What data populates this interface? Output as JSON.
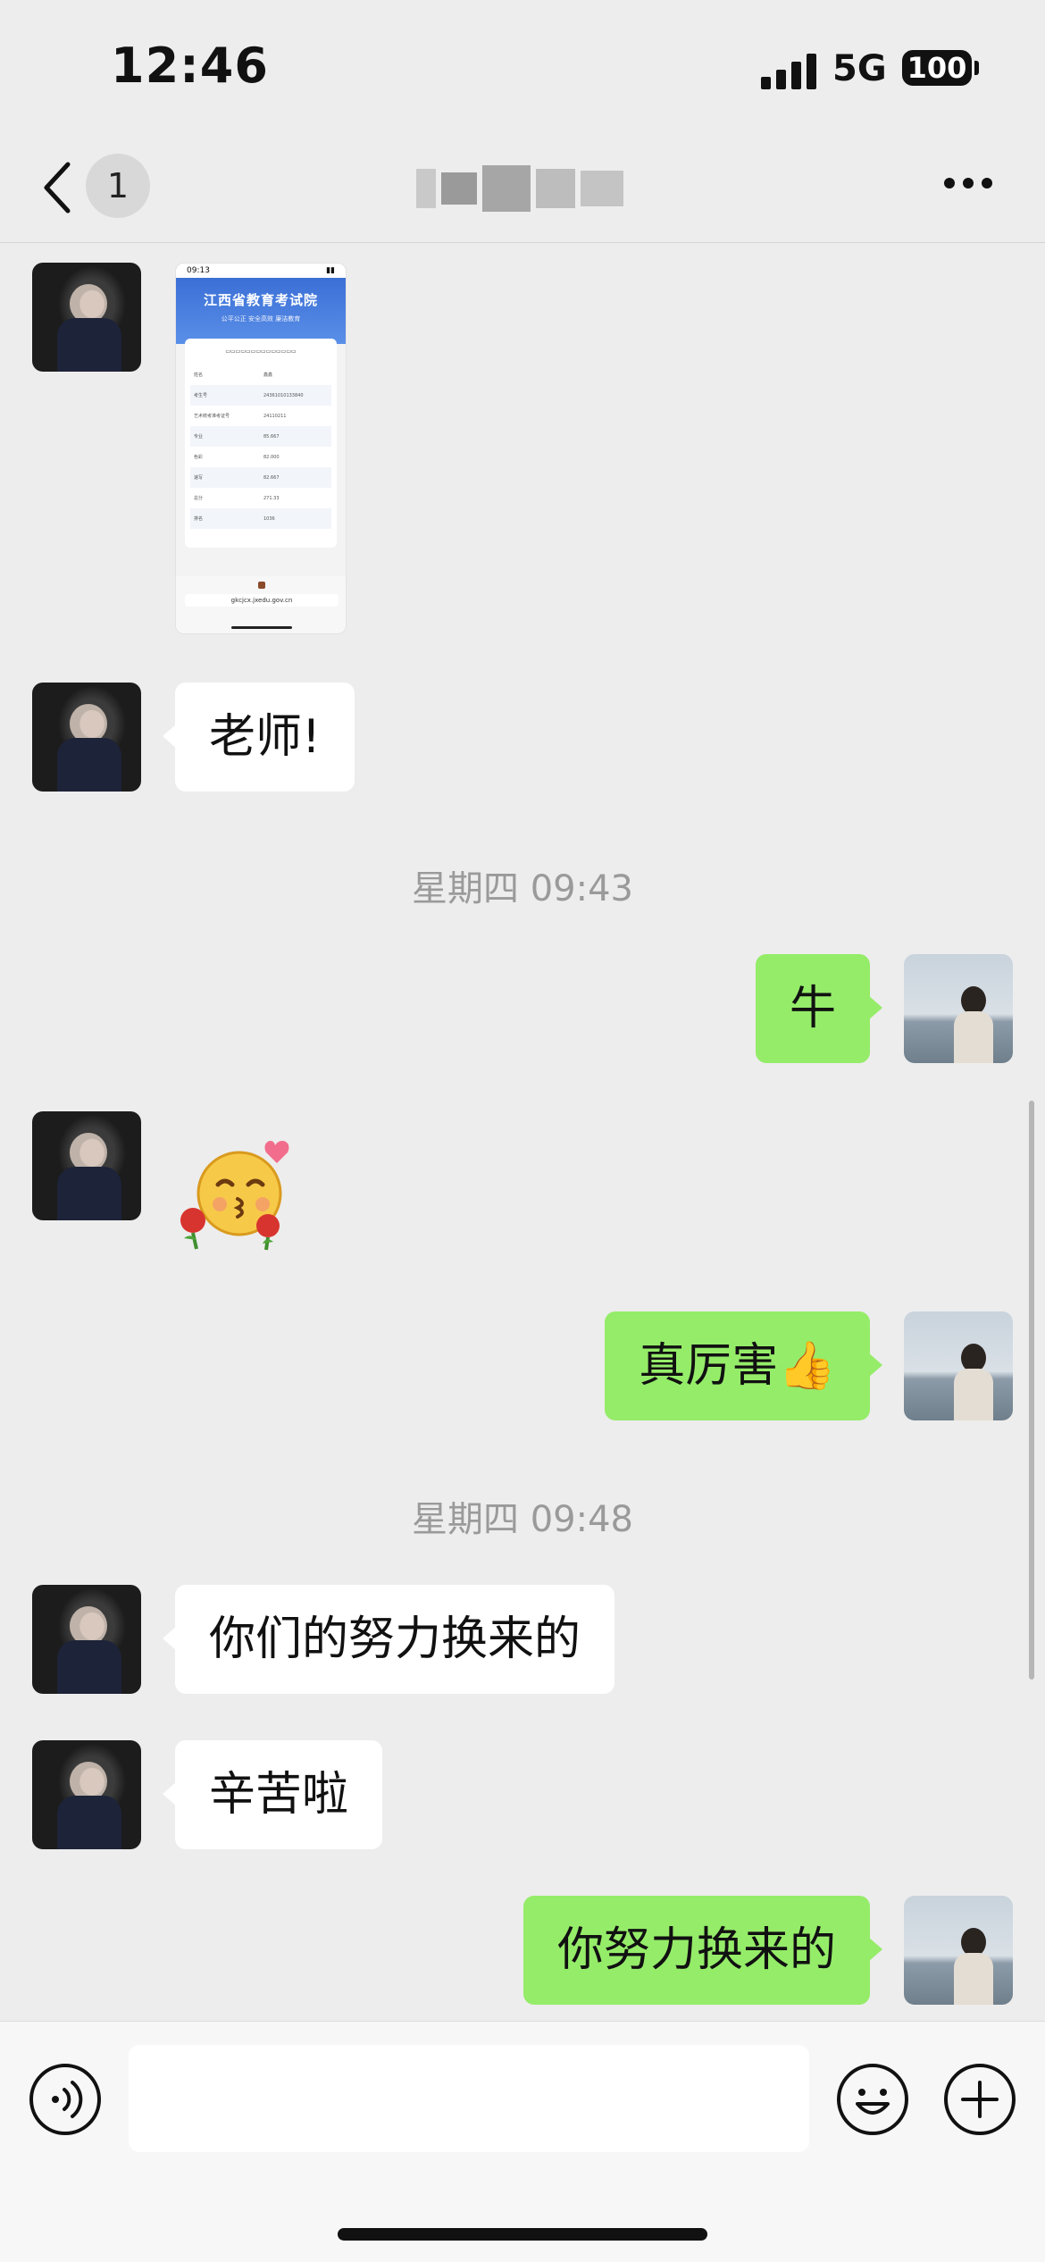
{
  "status_bar": {
    "time": "12:46",
    "network": "5G",
    "battery": "100"
  },
  "nav": {
    "unread_count": "1",
    "title": ""
  },
  "thumbnail": {
    "time": "09:13",
    "header_title": "江西省教育考试院",
    "header_subtitle": "公平公正 安全高效 廉洁教育",
    "url": "gkcjcx.jxedu.gov.cn",
    "rows": [
      {
        "label": "姓名",
        "value": "鑫鑫"
      },
      {
        "label": "考生号",
        "value": "24361010133840"
      },
      {
        "label": "艺术统考准考证号",
        "value": "24110211"
      },
      {
        "label": "专业",
        "value": "85.667"
      },
      {
        "label": "色彩",
        "value": "82.000"
      },
      {
        "label": "速写",
        "value": "82.667"
      },
      {
        "label": "总分",
        "value": "271.33"
      },
      {
        "label": "排名",
        "value": "1036"
      }
    ]
  },
  "messages": [
    {
      "side": "left",
      "type": "image"
    },
    {
      "side": "left",
      "type": "text",
      "text": "老师!"
    },
    {
      "type": "time",
      "text": "星期四 09:43"
    },
    {
      "side": "right",
      "type": "text",
      "text": "牛"
    },
    {
      "side": "left",
      "type": "sticker",
      "icon": "kiss-face-roses-sticker"
    },
    {
      "side": "right",
      "type": "text",
      "text": "真厉害👍"
    },
    {
      "type": "time",
      "text": "星期四 09:48"
    },
    {
      "side": "left",
      "type": "text",
      "text": "你们的努力换来的"
    },
    {
      "side": "left",
      "type": "text",
      "text": "辛苦啦"
    },
    {
      "side": "right",
      "type": "text",
      "text": "你努力换来的"
    }
  ],
  "input": {
    "value": "",
    "placeholder": ""
  },
  "colors": {
    "background": "#ededed",
    "outgoing_bubble": "#95ec69",
    "incoming_bubble": "#ffffff",
    "timestamp": "#9a9a9a"
  }
}
